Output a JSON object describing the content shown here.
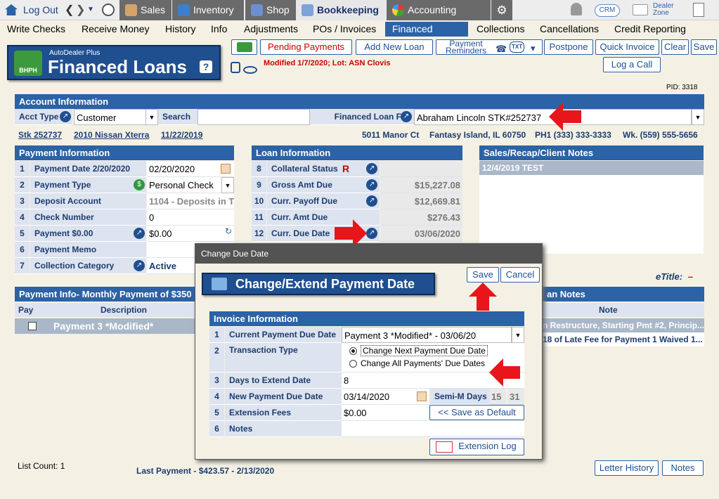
{
  "topnav": {
    "logout": "Log Out",
    "tabs": [
      {
        "label": "Sales"
      },
      {
        "label": "Inventory"
      },
      {
        "label": "Shop"
      },
      {
        "label": "Bookkeeping"
      },
      {
        "label": "Accounting"
      }
    ],
    "crm": "CRM",
    "dealer_zone": "Dealer Zone"
  },
  "subnav": [
    "Write Checks",
    "Receive Money",
    "History",
    "Info",
    "Adjustments",
    "POs / Invoices",
    "Financed Loans",
    "Collections",
    "Cancellations",
    "Credit Reporting"
  ],
  "badge": {
    "sub": "AutoDealer Plus",
    "main": "Financed Loans",
    "house": "BHPH",
    "help": "?"
  },
  "toolbar": {
    "pending": "Pending Payments",
    "add_loan": "Add New Loan",
    "reminders": "Payment Reminders",
    "txt": "TXT",
    "postpone": "Postpone",
    "quick_invoice": "Quick Invoice",
    "clear": "Clear",
    "save": "Save",
    "log_call": "Log a Call"
  },
  "modified": "Modified 1/7/2020; Lot: ASN Clovis",
  "pid": "PID: 3318",
  "account": {
    "header": "Account Information",
    "acct_type_label": "Acct Type",
    "acct_type_value": "Customer",
    "search_label": "Search",
    "financed_for_label": "Financed Loan For",
    "financed_for_value": "Abraham Lincoln STK#252737",
    "stk": "Stk 252737",
    "vehicle": "2010 Nissan Xterra",
    "date": "11/22/2019",
    "address": "5011 Manor Ct",
    "city": "Fantasy Island, IL 60750",
    "ph1": "PH1 (333) 333-3333",
    "wk": "Wk. (559) 555-5656"
  },
  "payment": {
    "header": "Payment Information",
    "rows": [
      {
        "n": "1",
        "label": "Payment Date  2/20/2020",
        "value": "02/20/2020"
      },
      {
        "n": "2",
        "label": "Payment Type",
        "value": "Personal Check"
      },
      {
        "n": "3",
        "label": "Deposit Account",
        "value": "1104 - Deposits in T"
      },
      {
        "n": "4",
        "label": "Check Number",
        "value": "0"
      },
      {
        "n": "5",
        "label": "Payment  $0.00",
        "value": "$0.00"
      },
      {
        "n": "6",
        "label": "Payment Memo",
        "value": ""
      },
      {
        "n": "7",
        "label": "Collection Category",
        "value": "Active"
      }
    ]
  },
  "loan": {
    "header": "Loan Information",
    "rows": [
      {
        "n": "8",
        "label": "Collateral Status",
        "flag": "R",
        "value": ""
      },
      {
        "n": "9",
        "label": "Gross Amt Due",
        "value": "$15,227.08"
      },
      {
        "n": "10",
        "label": "Curr. Payoff Due",
        "value": "$12,669.81"
      },
      {
        "n": "11",
        "label": "Curr. Amt Due",
        "value": "$276.43"
      },
      {
        "n": "12",
        "label": "Curr. Due Date",
        "value": "03/06/2020"
      }
    ]
  },
  "notes": {
    "header": "Sales/Recap/Client Notes",
    "entry": "12/4/2019  TEST"
  },
  "etitle": {
    "label": "eTitle:",
    "value": "–"
  },
  "payinfo": {
    "header": "Payment Info- Monthly Payment of $350",
    "col_pay": "Pay",
    "col_desc": "Description",
    "row_desc": "Payment 3 *Modified*"
  },
  "loan_notes": {
    "header": "an Notes",
    "col_note": "Note",
    "rows": [
      "n Restructure, Starting Pmt #2, Princip...",
      "18 of Late Fee for Payment 1 Waived 1..."
    ]
  },
  "footer": {
    "list_count": "List Count:  1",
    "last_payment": "Last Payment - $423.57 - 2/13/2020",
    "letter_history": "Letter History",
    "notes": "Notes"
  },
  "dialog": {
    "title": "Change Due Date",
    "badge": "Change/Extend Payment Date",
    "save": "Save",
    "cancel": "Cancel",
    "invoice_header": "Invoice Information",
    "rows": [
      {
        "n": "1",
        "label": "Current Payment Due Date",
        "value": "Payment 3 *Modified* - 03/06/20"
      },
      {
        "n": "2",
        "label": "Transaction Type",
        "value": ""
      },
      {
        "n": "3",
        "label": "Days to Extend Date",
        "value": "8"
      },
      {
        "n": "4",
        "label": "New Payment Due Date",
        "value": "03/14/2020"
      },
      {
        "n": "5",
        "label": "Extension Fees",
        "value": "$0.00"
      },
      {
        "n": "6",
        "label": "Notes",
        "value": ""
      }
    ],
    "radio_next": "Change Next Payment Due Date",
    "radio_all": "Change All Payments' Due Dates",
    "semi_label": "Semi-M Days",
    "semi_15": "15",
    "semi_31": "31",
    "save_default": "<<  Save as Default",
    "ext_log": "Extension Log"
  },
  "colors": {
    "primary": "#2c62a6",
    "header_dark": "#1f4f8f",
    "accent_red": "#e8151b"
  }
}
